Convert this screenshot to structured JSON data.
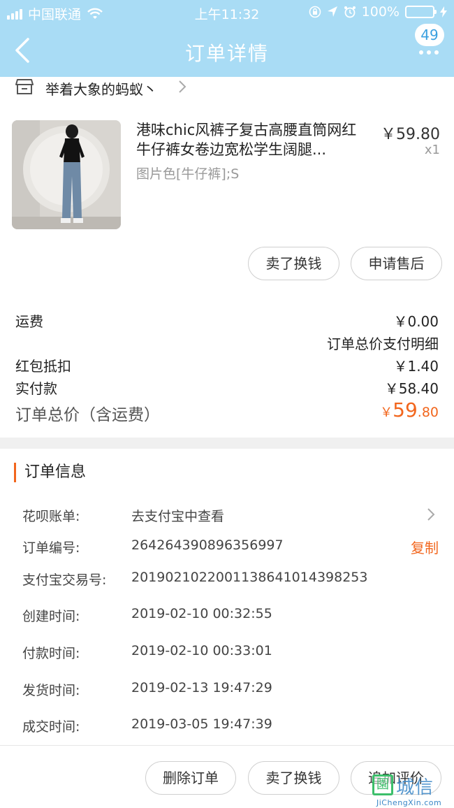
{
  "status_bar": {
    "carrier": "中国联通",
    "time": "上午11:32",
    "battery": "100%"
  },
  "nav": {
    "title": "订单详情",
    "badge": "49"
  },
  "shop": {
    "name": "举着大象的蚂蚁丶"
  },
  "product": {
    "title": "港味chic风裤子复古高腰直筒网红牛仔裤女卷边宽松学生阔腿...",
    "sku": "图片色[牛仔裤];S",
    "price": "￥59.80",
    "qty": "x1"
  },
  "item_actions": {
    "sell": "卖了换钱",
    "after_sale": "申请售后"
  },
  "fees": {
    "shipping_label": "运费",
    "shipping_value": "￥0.00",
    "detail_link": "订单总价支付明细",
    "redpacket_label": "红包抵扣",
    "redpacket_value": "￥1.40",
    "paid_label": "实付款",
    "paid_value": "￥58.40",
    "total_label": "订单总价（含运费）",
    "total_currency": "￥",
    "total_int": "59",
    "total_dec": ".80"
  },
  "order_info": {
    "section_title": "订单信息",
    "rows": [
      {
        "label": "花呗账单:",
        "value": "去支付宝中查看"
      },
      {
        "label": "订单编号:",
        "value": "264264390896356997"
      },
      {
        "label": "支付宝交易号:",
        "value": "2019021022001138641014398253"
      },
      {
        "label": "创建时间:",
        "value": "2019-02-10 00:32:55"
      },
      {
        "label": "付款时间:",
        "value": "2019-02-10 00:33:01"
      },
      {
        "label": "发货时间:",
        "value": "2019-02-13 19:47:29"
      },
      {
        "label": "成交时间:",
        "value": "2019-03-05 19:47:39"
      }
    ],
    "copy": "复制"
  },
  "bottom_actions": {
    "delete": "删除订单",
    "sell": "卖了换钱",
    "review": "追加评价"
  },
  "watermark": {
    "box": "園",
    "brand": "城信",
    "url": "JiChengXin.com"
  },
  "colors": {
    "header_bg": "#a9dcf5",
    "accent": "#f2661d",
    "battery": "#4cd964"
  }
}
